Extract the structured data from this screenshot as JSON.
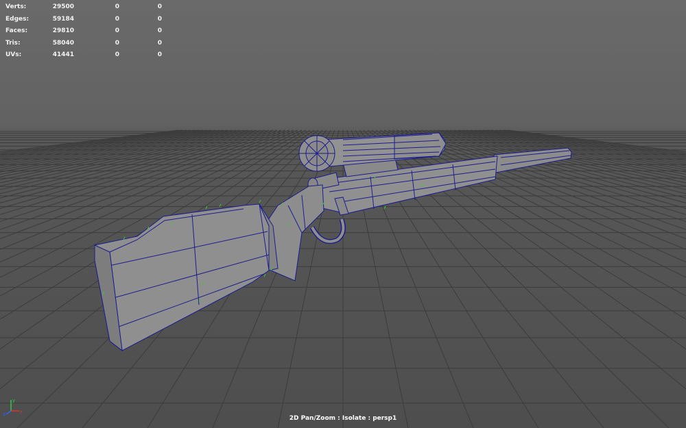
{
  "stats": {
    "rows": [
      {
        "label": "Verts:",
        "value": "29500",
        "sel1": "0",
        "sel2": "0"
      },
      {
        "label": "Edges:",
        "value": "59184",
        "sel1": "0",
        "sel2": "0"
      },
      {
        "label": "Faces:",
        "value": "29810",
        "sel1": "0",
        "sel2": "0"
      },
      {
        "label": "Tris:",
        "value": "58040",
        "sel1": "0",
        "sel2": "0"
      },
      {
        "label": "UVs:",
        "value": "41441",
        "sel1": "0",
        "sel2": "0"
      }
    ]
  },
  "viewport": {
    "camera_label": "2D Pan/Zoom : Isolate : persp1",
    "axis": {
      "x": "x",
      "y": "y",
      "z": "z"
    }
  },
  "colors": {
    "grid": "#3b3b3b",
    "mesh_fill": "#8f8f8f",
    "mesh_wire": "#1a1a8c",
    "normals": "#30d030"
  }
}
